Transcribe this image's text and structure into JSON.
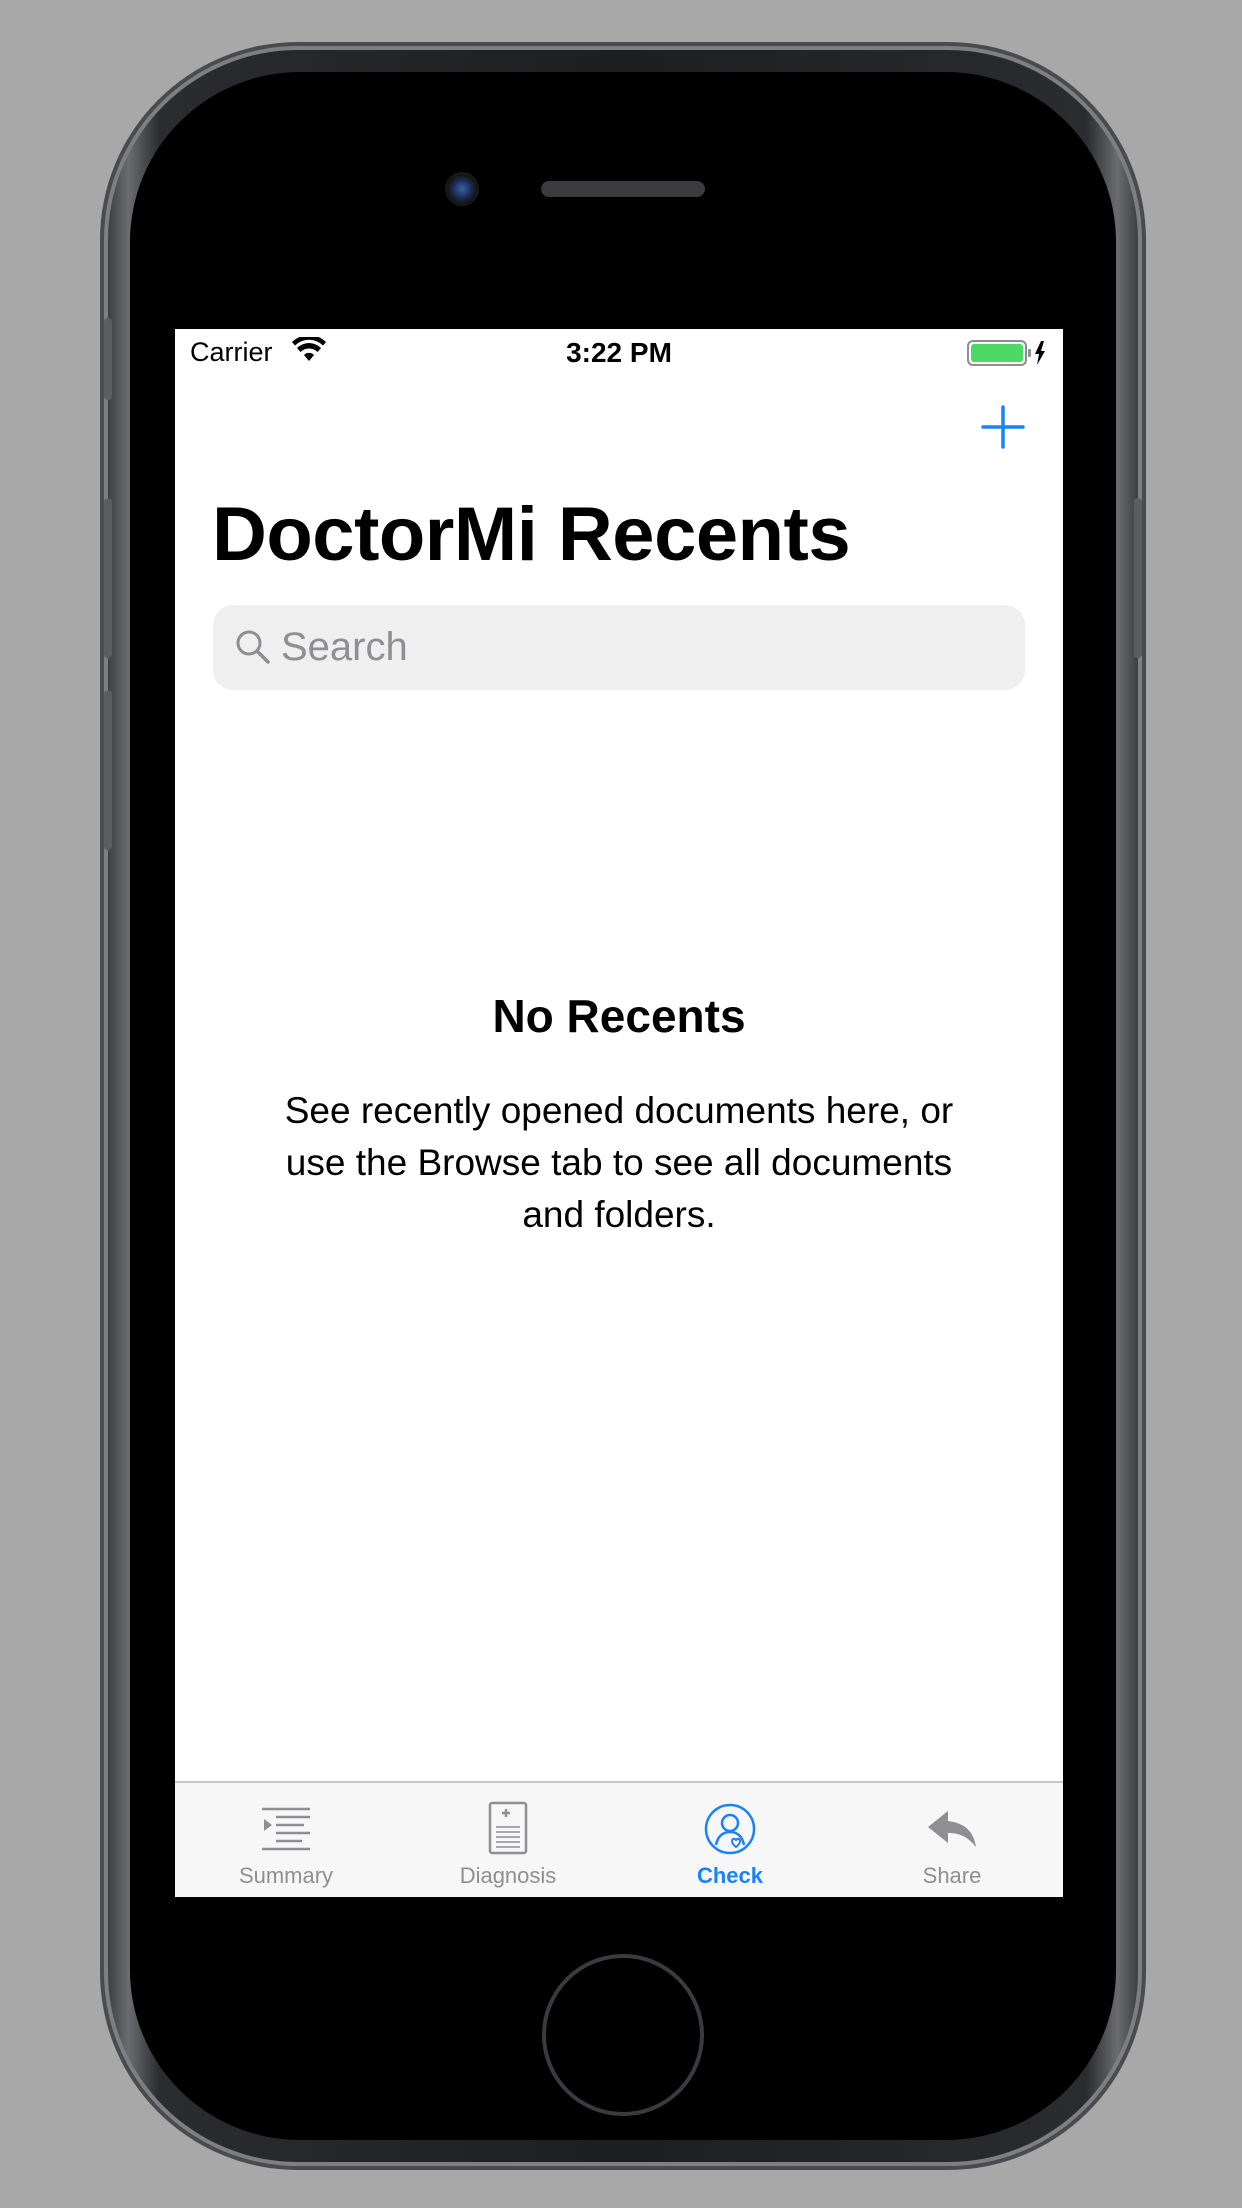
{
  "status_bar": {
    "carrier": "Carrier",
    "time": "3:22 PM",
    "icons": [
      "wifi-icon",
      "battery-icon",
      "charging-bolt-icon"
    ]
  },
  "nav": {
    "add_icon": "plus-icon",
    "title": "DoctorMi Recents"
  },
  "search": {
    "placeholder": "Search",
    "value": ""
  },
  "empty_state": {
    "title": "No Recents",
    "description": "See recently opened documents here, or use the Browse tab to see all documents and folders."
  },
  "tabs": [
    {
      "label": "Summary",
      "icon": "summary-list-icon",
      "active": false
    },
    {
      "label": "Diagnosis",
      "icon": "diagnosis-document-icon",
      "active": false
    },
    {
      "label": "Check",
      "icon": "check-person-icon",
      "active": true
    },
    {
      "label": "Share",
      "icon": "share-reply-icon",
      "active": false
    }
  ],
  "colors": {
    "accent": "#1a82f7",
    "inactive": "#8e8e93",
    "battery": "#4cd964",
    "background_outer": "#a8a8a8"
  }
}
